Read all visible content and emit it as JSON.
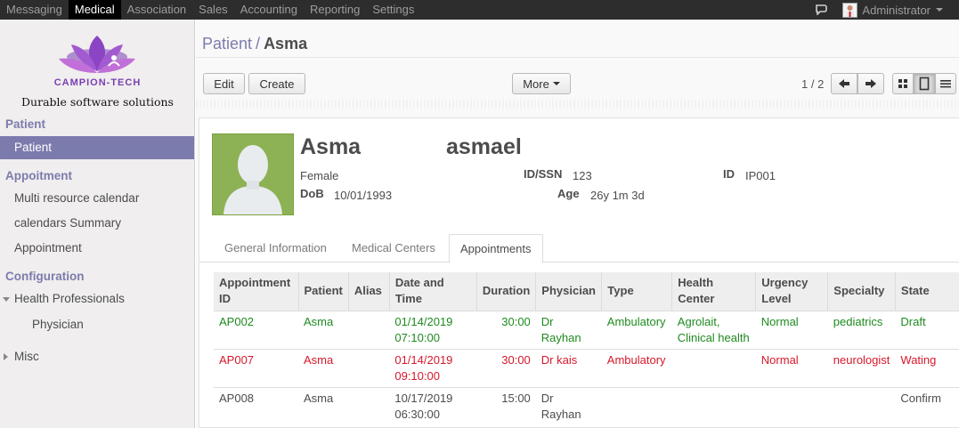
{
  "topbar": {
    "menu": [
      "Messaging",
      "Medical",
      "Association",
      "Sales",
      "Accounting",
      "Reporting",
      "Settings"
    ],
    "active_index": 1,
    "user": "Administrator"
  },
  "sidebar": {
    "brand": "CAMPION-TECH",
    "tagline": "Durable software solutions",
    "sections": [
      {
        "title": "Patient",
        "items": [
          {
            "label": "Patient",
            "active": true
          }
        ]
      },
      {
        "title": "Appoitment",
        "items": [
          {
            "label": "Multi resource calendar"
          },
          {
            "label": "calendars Summary"
          },
          {
            "label": "Appointment"
          }
        ]
      },
      {
        "title": "Configuration",
        "items": [
          {
            "label": "Health Professionals",
            "expanded": true
          },
          {
            "label": "Physician",
            "sub": true
          },
          {
            "label": "Misc",
            "collapsed": true
          }
        ]
      }
    ]
  },
  "breadcrumb": {
    "parent": "Patient",
    "separator": "/",
    "current": "Asma"
  },
  "buttons": {
    "edit": "Edit",
    "create": "Create",
    "more": "More"
  },
  "pager": {
    "text": "1 / 2"
  },
  "patient": {
    "first_name": "Asma",
    "last_name": "asmael",
    "gender": "Female",
    "dob_label": "DoB",
    "dob": "10/01/1993",
    "idssn_label": "ID/SSN",
    "idssn": "123",
    "age_label": "Age",
    "age": "26y 1m 3d",
    "id_label": "ID",
    "id": "IP001"
  },
  "tabs": [
    "General Information",
    "Medical Centers",
    "Appointments"
  ],
  "active_tab": 2,
  "table": {
    "headers": [
      "Appointment ID",
      "Patient",
      "Alias",
      "Date and Time",
      "Duration",
      "Physician",
      "Type",
      "Health Center",
      "Urgency Level",
      "Specialty",
      "State"
    ],
    "rows": [
      {
        "status": "green",
        "cells": [
          "AP002",
          "Asma",
          "",
          "01/14/2019 07:10:00",
          "30:00",
          "Dr Rayhan",
          "Ambulatory",
          "Agrolait, Clinical health",
          "Normal",
          "pediatrics",
          "Draft"
        ]
      },
      {
        "status": "red",
        "cells": [
          "AP007",
          "Asma",
          "",
          "01/14/2019 09:10:00",
          "30:00",
          "Dr kais",
          "Ambulatory",
          "",
          "Normal",
          "neurologist",
          "Wating"
        ]
      },
      {
        "status": "plain",
        "cells": [
          "AP008",
          "Asma",
          "",
          "10/17/2019 06:30:00",
          "15:00",
          "Dr Rayhan",
          "",
          "",
          "",
          "",
          "Confirm"
        ]
      }
    ]
  },
  "colors": {
    "accent": "#7c7bad",
    "green": "#1f8a1f",
    "red": "#d6182a",
    "topbar": "#2d2d2d"
  },
  "icons": [
    "chat-icon",
    "avatar",
    "arrow-left-icon",
    "arrow-right-icon",
    "kanban-view-icon",
    "form-view-icon",
    "list-view-icon",
    "lotus-logo-icon",
    "patient-photo-icon"
  ]
}
